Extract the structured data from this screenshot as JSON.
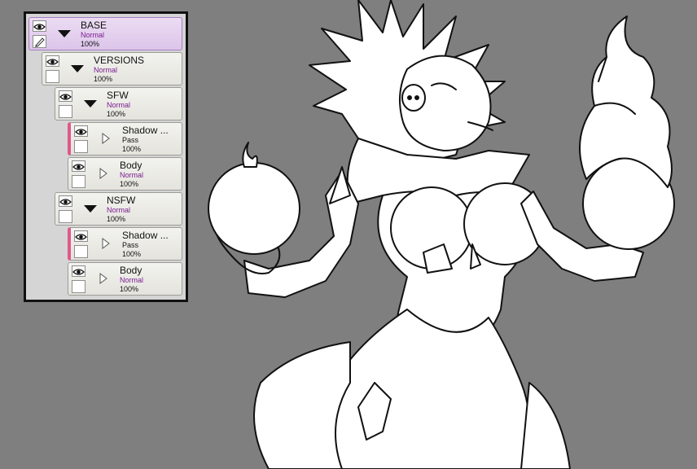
{
  "colors": {
    "canvas_bg": "#7f7f7f",
    "panel_bg": "#d5d5d5",
    "selected_row": "#dcc5ea",
    "blend_mode_text": "#7a1b8f",
    "clip_indicator": "#e0588a"
  },
  "layers": [
    {
      "name": "BASE",
      "mode": "Normal",
      "opacity": "100%",
      "type": "folder",
      "expanded": true,
      "selected": true,
      "visibility_icon": "eye-icon",
      "thumb_icon": "pencil-icon"
    },
    {
      "name": "VERSIONS",
      "mode": "Normal",
      "opacity": "100%",
      "type": "folder",
      "expanded": true,
      "visibility_icon": "eye-icon"
    },
    {
      "name": "SFW",
      "mode": "Normal",
      "opacity": "100%",
      "type": "folder",
      "expanded": true,
      "visibility_icon": "eye-icon"
    },
    {
      "name": "Shadow ...",
      "mode": "Pass",
      "opacity": "100%",
      "type": "folder",
      "expanded": false,
      "clipped": true,
      "visibility_icon": "eye-icon"
    },
    {
      "name": "Body",
      "mode": "Normal",
      "opacity": "100%",
      "type": "folder",
      "expanded": false,
      "visibility_icon": "eye-icon"
    },
    {
      "name": "NSFW",
      "mode": "Normal",
      "opacity": "100%",
      "type": "folder",
      "expanded": true,
      "visibility_icon": "eye-icon"
    },
    {
      "name": "Shadow ...",
      "mode": "Pass",
      "opacity": "100%",
      "type": "folder",
      "expanded": false,
      "clipped": true,
      "visibility_icon": "eye-icon"
    },
    {
      "name": "Body",
      "mode": "Normal",
      "opacity": "100%",
      "type": "folder",
      "expanded": false,
      "visibility_icon": "eye-icon"
    }
  ]
}
